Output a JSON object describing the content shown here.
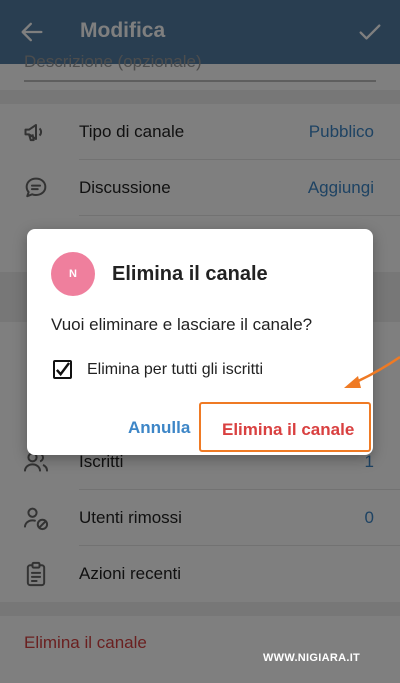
{
  "appbar": {
    "title": "Modifica",
    "back_icon": "arrow-left-icon",
    "confirm_icon": "check-icon"
  },
  "description": {
    "placeholder": "Descrizione (opzionale)"
  },
  "settings_rows": [
    {
      "label": "Tipo di canale",
      "value": "Pubblico",
      "icon": "megaphone-icon"
    },
    {
      "label": "Discussione",
      "value": "Aggiungi",
      "icon": "chat-bubble-icon"
    }
  ],
  "member_rows": [
    {
      "label": "Iscritti",
      "value": "1",
      "icon": "users-icon"
    },
    {
      "label": "Utenti rimossi",
      "value": "0",
      "icon": "user-blocked-icon"
    },
    {
      "label": "Azioni recenti",
      "value": "",
      "icon": "clipboard-icon"
    }
  ],
  "danger_action": "Elimina il canale",
  "dialog": {
    "avatar_initial": "N",
    "avatar_color": "#ef7f9d",
    "title": "Elimina il canale",
    "message": "Vuoi eliminare e lasciare il canale?",
    "checkbox_label": "Elimina per tutti gli iscritti",
    "checkbox_checked": true,
    "cancel_label": "Annulla",
    "confirm_label": "Elimina il canale"
  },
  "annotation_color": "#ef7a24",
  "watermark": "WWW.NIGIARA.IT",
  "colors": {
    "appbar": "#527da3",
    "link": "#3d86c7",
    "danger": "#d54040"
  }
}
